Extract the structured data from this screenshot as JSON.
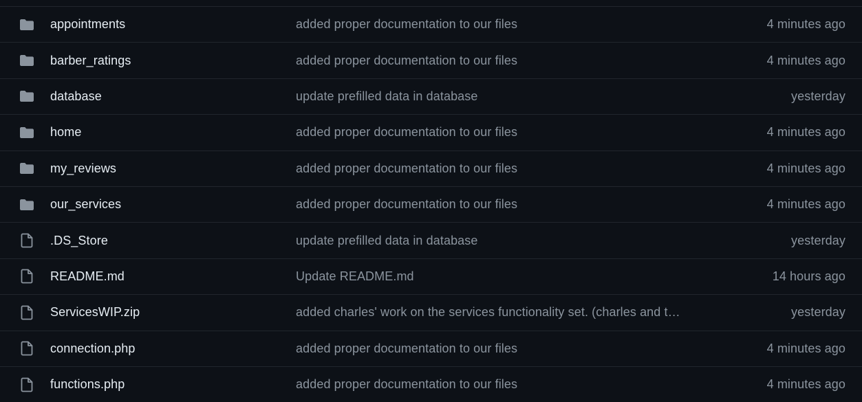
{
  "colors": {
    "background": "#0d1117",
    "divider": "#21262d",
    "folder_icon": "#8b949e",
    "file_icon": "#8b949e",
    "name_text": "#e6edf3",
    "muted_text": "#8b949e"
  },
  "files": [
    {
      "type": "folder",
      "icon": "folder-icon",
      "name": "appointments",
      "message": "added proper documentation to our files",
      "age": "4 minutes ago"
    },
    {
      "type": "folder",
      "icon": "folder-icon",
      "name": "barber_ratings",
      "message": "added proper documentation to our files",
      "age": "4 minutes ago"
    },
    {
      "type": "folder",
      "icon": "folder-icon",
      "name": "database",
      "message": "update prefilled data in database",
      "age": "yesterday"
    },
    {
      "type": "folder",
      "icon": "folder-icon",
      "name": "home",
      "message": "added proper documentation to our files",
      "age": "4 minutes ago"
    },
    {
      "type": "folder",
      "icon": "folder-icon",
      "name": "my_reviews",
      "message": "added proper documentation to our files",
      "age": "4 minutes ago"
    },
    {
      "type": "folder",
      "icon": "folder-icon",
      "name": "our_services",
      "message": "added proper documentation to our files",
      "age": "4 minutes ago"
    },
    {
      "type": "file",
      "icon": "file-icon",
      "name": ".DS_Store",
      "message": "update prefilled data in database",
      "age": "yesterday"
    },
    {
      "type": "file",
      "icon": "file-icon",
      "name": "README.md",
      "message": "Update README.md",
      "age": "14 hours ago"
    },
    {
      "type": "file",
      "icon": "file-icon",
      "name": "ServicesWIP.zip",
      "message": "added charles' work on the services functionality set. (charles and t…",
      "age": "yesterday"
    },
    {
      "type": "file",
      "icon": "file-icon",
      "name": "connection.php",
      "message": "added proper documentation to our files",
      "age": "4 minutes ago"
    },
    {
      "type": "file",
      "icon": "file-icon",
      "name": "functions.php",
      "message": "added proper documentation to our files",
      "age": "4 minutes ago"
    }
  ]
}
